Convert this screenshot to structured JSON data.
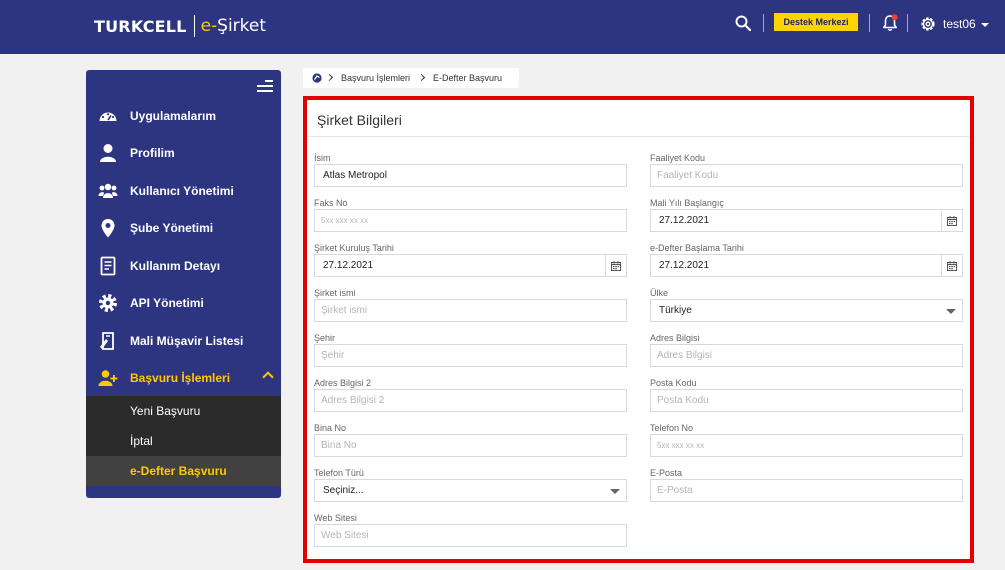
{
  "header": {
    "brand_main": "TURKCELL",
    "brand_sub_prefix": "e-",
    "brand_sub_suffix": "Şirket",
    "support_label": "Destek Merkezi",
    "user_name": "test06",
    "icons": [
      "search-icon",
      "bell-icon",
      "gear-icon",
      "chevron-down-icon"
    ]
  },
  "colors": {
    "nav": "#2d3580",
    "accent": "#ffc900",
    "highlight_border": "#e30000",
    "submenu_bg": "#2b2b2b"
  },
  "sidebar": {
    "items": [
      {
        "label": "Uygulamalarım",
        "icon": "dashboard-icon"
      },
      {
        "label": "Profilim",
        "icon": "user-icon"
      },
      {
        "label": "Kullanıcı Yönetimi",
        "icon": "users-icon"
      },
      {
        "label": "Şube Yönetimi",
        "icon": "map-pin-icon"
      },
      {
        "label": "Kullanım Detayı",
        "icon": "document-icon"
      },
      {
        "label": "API Yönetimi",
        "icon": "cog-icon"
      },
      {
        "label": "Mali Müşavir Listesi",
        "icon": "contract-icon"
      },
      {
        "label": "Başvuru İşlemleri",
        "icon": "user-add-icon",
        "active": true
      }
    ],
    "subitems": [
      {
        "label": "Yeni Başvuru"
      },
      {
        "label": "İptal"
      },
      {
        "label": "e-Defter Başvuru",
        "active": true
      }
    ]
  },
  "breadcrumb": {
    "link": "Başvuru İşlemleri",
    "current": "E-Defter Başvuru"
  },
  "form": {
    "title": "Şirket Bilgileri",
    "fields": {
      "isim": {
        "label": "İsim",
        "value": "Atlas Metropol"
      },
      "faaliyet_kodu": {
        "label": "Faaliyet Kodu",
        "placeholder": "Faaliyet Kodu"
      },
      "faks_no": {
        "label": "Faks No",
        "placeholder": "5xx xxx xx xx"
      },
      "mali_yil": {
        "label": "Mali Yılı Başlangıç",
        "value": "27.12.2021"
      },
      "kurulus_tarihi": {
        "label": "Şirket Kuruluş Tarihi",
        "value": "27.12.2021"
      },
      "edefter_tarihi": {
        "label": "e-Defter Başlama Tarihi",
        "value": "27.12.2021"
      },
      "sirket_ismi": {
        "label": "Şirket ismi",
        "placeholder": "Şirket ismi"
      },
      "ulke": {
        "label": "Ülke",
        "value": "Türkiye"
      },
      "sehir": {
        "label": "Şehir",
        "placeholder": "Şehir"
      },
      "adres1": {
        "label": "Adres Bilgisi",
        "placeholder": "Adres Bilgisi"
      },
      "adres2": {
        "label": "Adres Bilgisi 2",
        "placeholder": "Adres Bilgisi 2"
      },
      "posta_kodu": {
        "label": "Posta Kodu",
        "placeholder": "Posta Kodu"
      },
      "bina_no": {
        "label": "Bina No",
        "placeholder": "Bina No"
      },
      "telefon_no": {
        "label": "Telefon No",
        "placeholder": "5xx xxx xx xx"
      },
      "telefon_turu": {
        "label": "Telefon Türü",
        "value": "Seçiniz..."
      },
      "eposta": {
        "label": "E-Posta",
        "placeholder": "E-Posta"
      },
      "web_sitesi": {
        "label": "Web Sitesi",
        "placeholder": "Web Sitesi"
      }
    }
  }
}
